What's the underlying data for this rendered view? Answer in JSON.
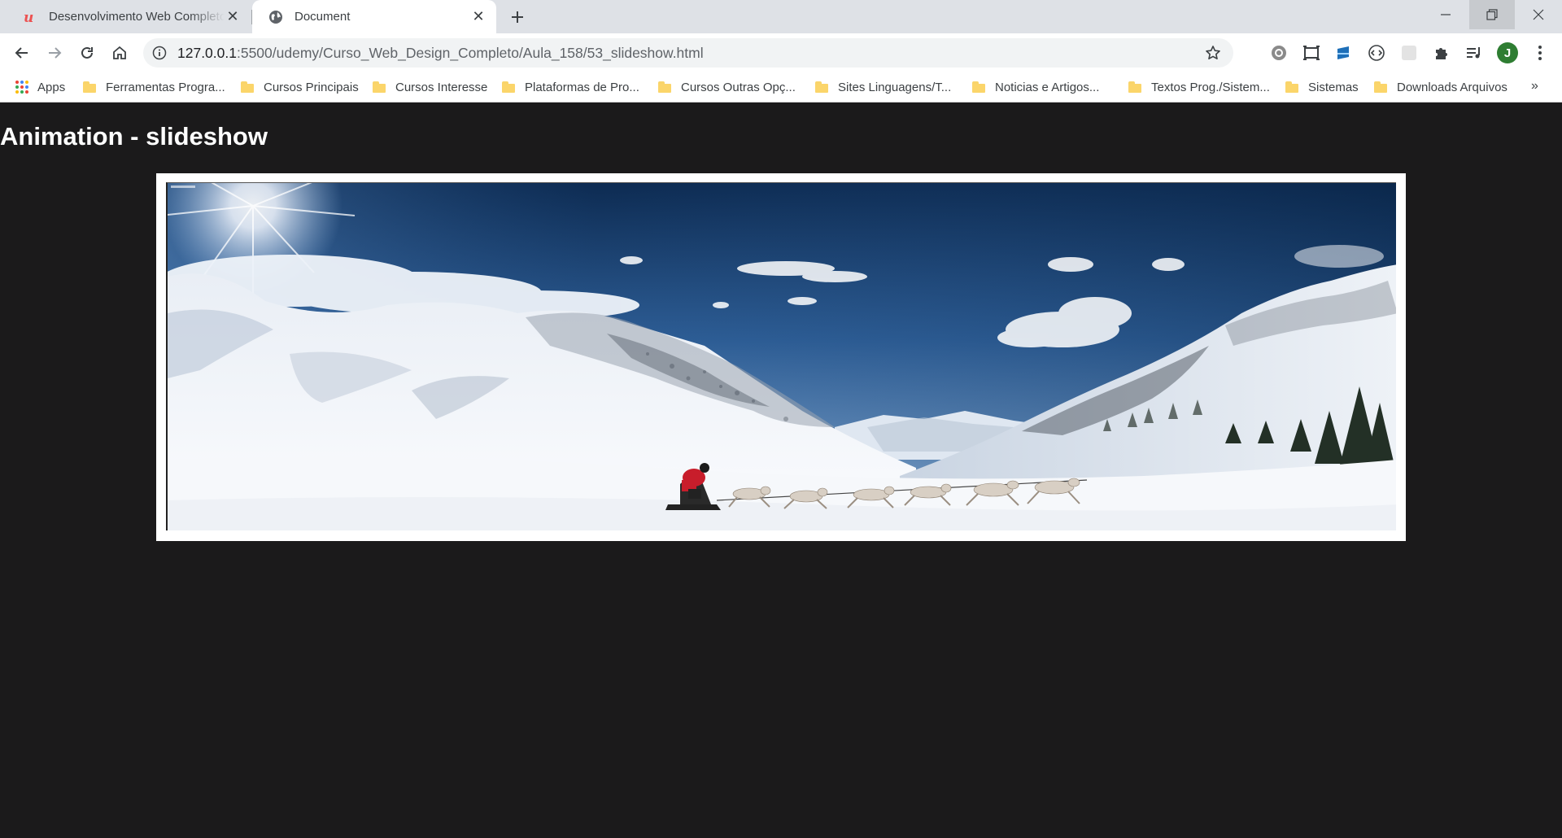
{
  "browser": {
    "tabs": [
      {
        "title": "Desenvolvimento Web Completo",
        "active": false,
        "icon": "udemy-icon"
      },
      {
        "title": "Document",
        "active": true,
        "icon": "globe-icon"
      }
    ],
    "address": {
      "host": "127.0.0.1",
      "path": ":5500/udemy/Curso_Web_Design_Completo/Aula_158/53_slideshow.html"
    },
    "profile_initial": "J",
    "bookmarks": [
      {
        "label": "Apps",
        "icon": "apps-grid-icon"
      },
      {
        "label": "Ferramentas Progra...",
        "icon": "folder-icon"
      },
      {
        "label": "Cursos Principais",
        "icon": "folder-icon"
      },
      {
        "label": "Cursos Interesse",
        "icon": "folder-icon"
      },
      {
        "label": "Plataformas de Pro...",
        "icon": "folder-icon"
      },
      {
        "label": "Cursos Outras Opç...",
        "icon": "folder-icon"
      },
      {
        "label": "Sites Linguagens/T...",
        "icon": "folder-icon"
      },
      {
        "label": "Noticias e Artigos...",
        "icon": "folder-icon"
      },
      {
        "label": "Textos Prog./Sistem...",
        "icon": "folder-icon"
      },
      {
        "label": "Sistemas",
        "icon": "folder-icon"
      },
      {
        "label": "Downloads Arquivos",
        "icon": "folder-icon"
      }
    ],
    "bookmarks_overflow": "»"
  },
  "page": {
    "heading": "Animation - slideshow",
    "slide_image": "snowy-mountain-dog-sled-photo",
    "background_color": "#1b1a1b"
  }
}
